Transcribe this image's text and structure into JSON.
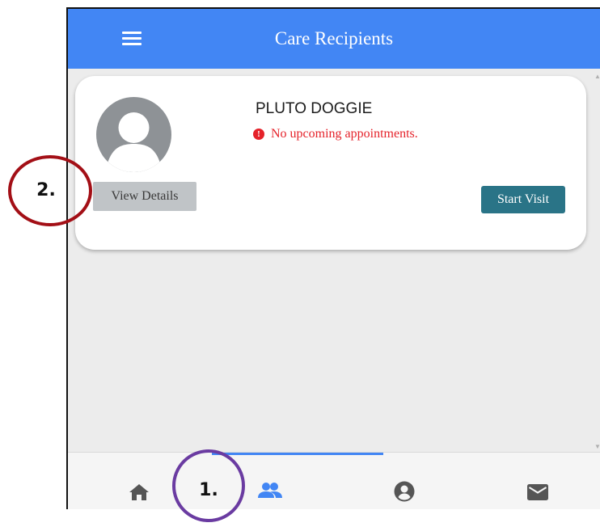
{
  "app": {
    "title": "Care Recipients"
  },
  "recipient": {
    "name": "PLUTO DOGGIE",
    "appointment_status": "No upcoming appointments.",
    "view_details_label": "View Details",
    "start_visit_label": "Start Visit"
  },
  "bottom_nav": {
    "items": [
      {
        "icon": "home-icon",
        "active": false
      },
      {
        "icon": "people-icon",
        "active": true
      },
      {
        "icon": "account-circle-icon",
        "active": false
      },
      {
        "icon": "mail-icon",
        "active": false
      }
    ]
  },
  "annotations": {
    "marker_1": "1.",
    "marker_2": "2."
  },
  "colors": {
    "app_bar": "#4286f4",
    "start_visit_button": "#2a7487",
    "view_details_button": "#c0c4c7",
    "alert_text": "#e5222a",
    "marker_1_ring": "#6a3ba1",
    "marker_2_ring": "#a30f16",
    "active_nav": "#4286f4"
  }
}
